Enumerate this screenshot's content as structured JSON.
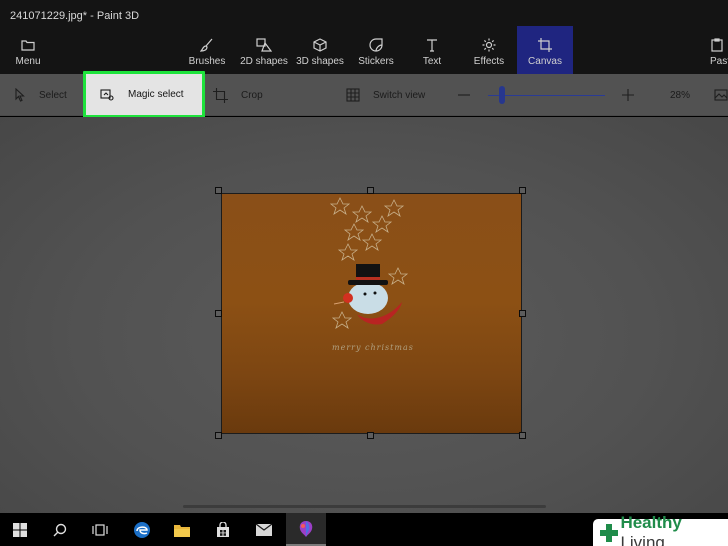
{
  "window": {
    "title": "241071229.jpg* - Paint 3D"
  },
  "ribbon": {
    "menu": "Menu",
    "brushes": "Brushes",
    "shapes2d": "2D shapes",
    "shapes3d": "3D shapes",
    "stickers": "Stickers",
    "text": "Text",
    "effects": "Effects",
    "canvas": "Canvas",
    "paste": "Past",
    "active_tab": "Canvas"
  },
  "toolbar": {
    "select": "Select",
    "magic_select": "Magic select",
    "crop": "Crop",
    "switch_view": "Switch view",
    "zoom": "28%",
    "zoom_level": 0.12
  },
  "canvas": {
    "image_text": "merry christmas"
  },
  "taskbar": {
    "icons": [
      "windows-icon",
      "search-icon",
      "task-view-icon",
      "edge-icon",
      "file-explorer-icon",
      "store-icon",
      "mail-icon",
      "paint-3d-icon"
    ]
  },
  "watermark": {
    "prefix": "Healthy",
    "suffix": " Living"
  },
  "colors": {
    "highlight": "#1ee33c",
    "active_tab": "#1f2580",
    "accent": "#27378e"
  }
}
